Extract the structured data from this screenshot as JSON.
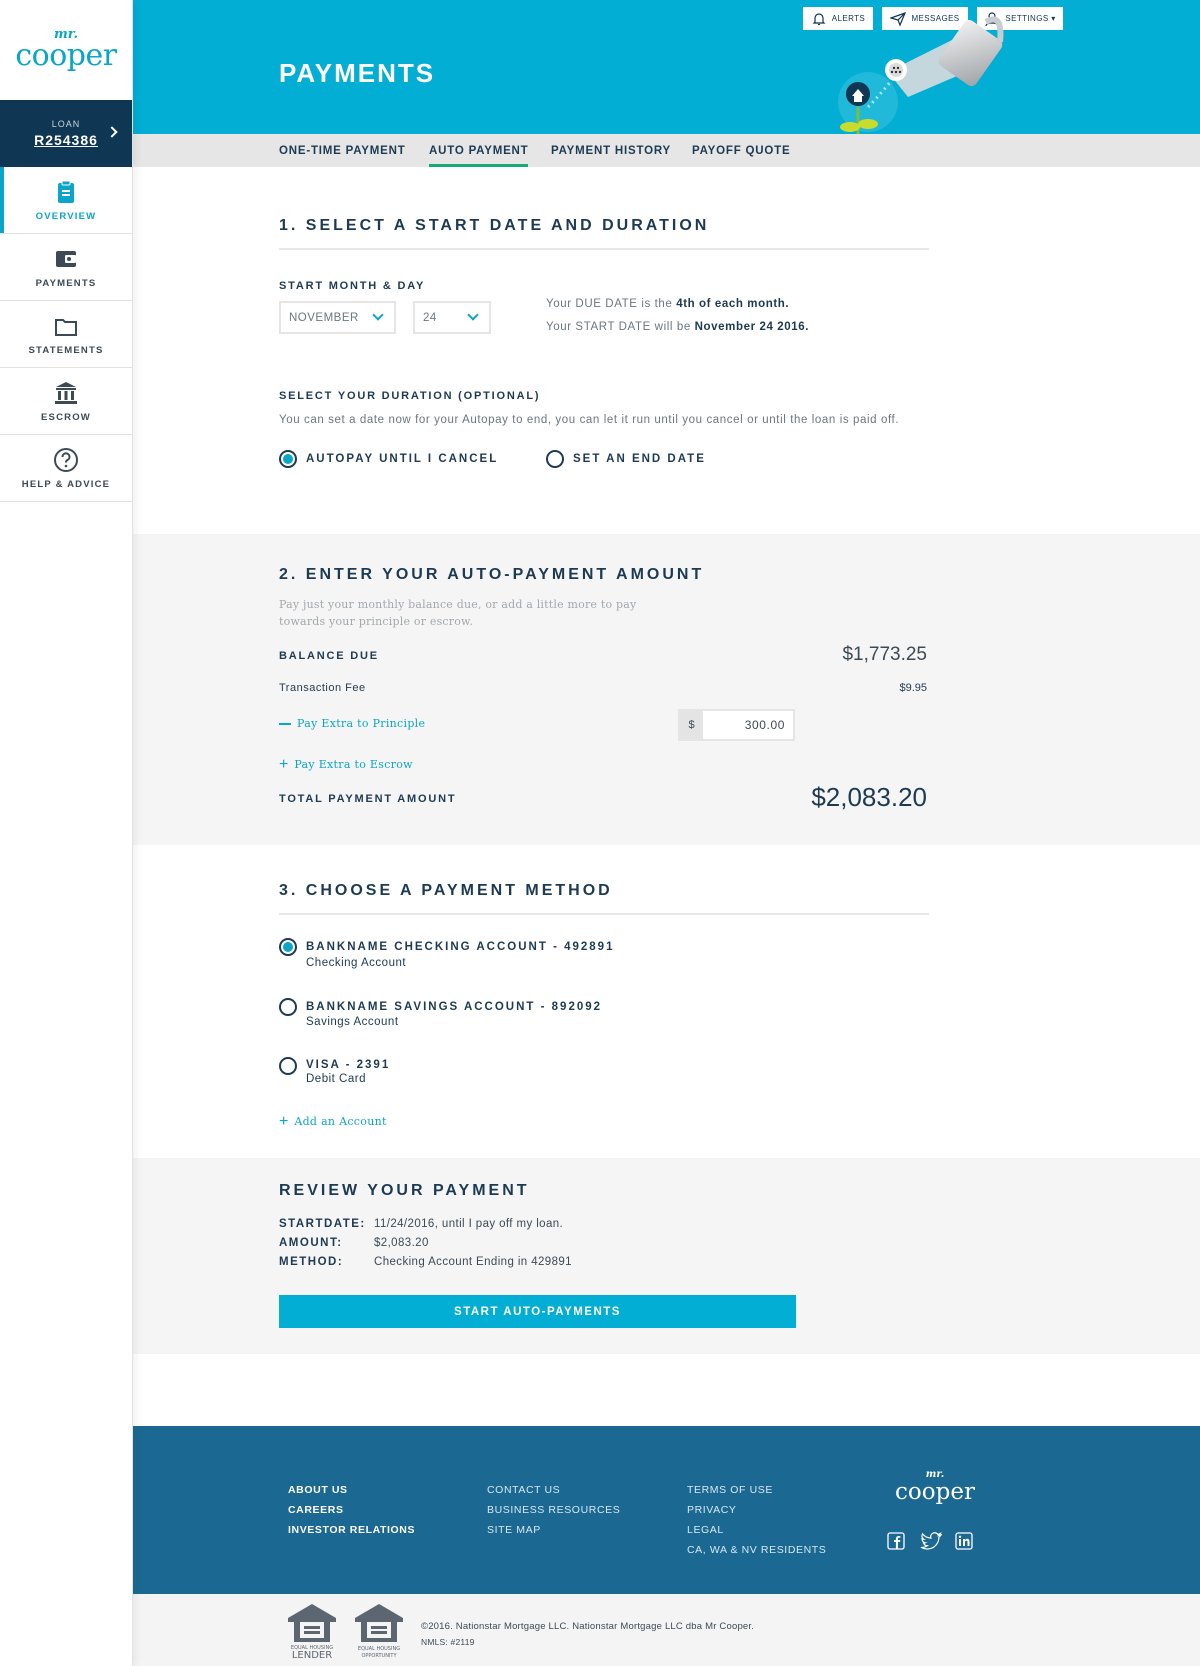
{
  "brand": {
    "mr": "mr.",
    "cooper": "cooper"
  },
  "loan": {
    "label": "LOAN",
    "number": "R254386"
  },
  "sidebar": {
    "items": [
      {
        "label": "OVERVIEW",
        "icon": "clipboard-icon"
      },
      {
        "label": "PAYMENTS",
        "icon": "wallet-icon"
      },
      {
        "label": "STATEMENTS",
        "icon": "folder-icon"
      },
      {
        "label": "ESCROW",
        "icon": "bank-icon"
      },
      {
        "label": "HELP & ADVICE",
        "icon": "question-icon"
      }
    ]
  },
  "header": {
    "title": "PAYMENTS",
    "alerts": "ALERTS",
    "messages": "MESSAGES",
    "settings": "SETTINGS ▾"
  },
  "tabs": [
    {
      "label": "ONE-TIME PAYMENT"
    },
    {
      "label": "AUTO PAYMENT",
      "active": true
    },
    {
      "label": "PAYMENT HISTORY"
    },
    {
      "label": "PAYOFF QUOTE"
    }
  ],
  "step1": {
    "heading": "1. SELECT A START DATE AND DURATION",
    "start_label": "START MONTH & DAY",
    "month": "NOVEMBER",
    "day": "24",
    "due_prefix": "Your DUE DATE is the ",
    "due_value": "4th of each month.",
    "start_prefix": "Your START DATE will be ",
    "start_value": "November 24 2016.",
    "duration_label": "SELECT YOUR DURATION (OPTIONAL)",
    "duration_help": "You can set a date now for your Autopay to end, you can let it run until you cancel or until the loan is paid off.",
    "option_cancel": "AUTOPAY UNTIL I CANCEL",
    "option_end": "SET AN END DATE"
  },
  "step2": {
    "heading": "2. ENTER YOUR AUTO-PAYMENT AMOUNT",
    "help": "Pay just your monthly balance due, or add a little more to pay towards your principle or escrow.",
    "balance_label": "BALANCE DUE",
    "balance_value": "$1,773.25",
    "fee_label": "Transaction Fee",
    "fee_value": "$9.95",
    "extra_principle_label": "Pay Extra to Principle",
    "currency": "$",
    "extra_principle_value": "300.00",
    "extra_escrow_label": "Pay Extra to Escrow",
    "total_label": "TOTAL PAYMENT AMOUNT",
    "total_value": "$2,083.20"
  },
  "step3": {
    "heading": "3. CHOOSE A PAYMENT METHOD",
    "methods": [
      {
        "name": "BANKNAME CHECKING ACCOUNT - 492891",
        "type": "Checking Account",
        "selected": true
      },
      {
        "name": "BANKNAME SAVINGS ACCOUNT - 892092",
        "type": "Savings Account"
      },
      {
        "name": "VISA - 2391",
        "type": "Debit Card"
      }
    ],
    "add_account": "Add an Account"
  },
  "review": {
    "heading": "REVIEW YOUR PAYMENT",
    "startdate_key": "STARTDATE:",
    "startdate_val": "11/24/2016, until I pay off my loan.",
    "amount_key": "AMOUNT:",
    "amount_val": "$2,083.20",
    "method_key": "METHOD:",
    "method_val": "Checking Account Ending in 429891",
    "button": "START AUTO-PAYMENTS"
  },
  "footer": {
    "col1": [
      "ABOUT US",
      "CAREERS",
      "INVESTOR RELATIONS"
    ],
    "col2": [
      "CONTACT US",
      "BUSINESS RESOURCES",
      "SITE MAP"
    ],
    "col3": [
      "TERMS OF USE",
      "PRIVACY",
      "LEGAL",
      "CA, WA & NV RESIDENTS"
    ],
    "social": [
      "facebook-icon",
      "twitter-icon",
      "linkedin-icon"
    ]
  },
  "legal": {
    "lender_badge": "EQUAL HOUSING LENDER",
    "opportunity_badge": "EQUAL HOUSING OPPORTUNITY",
    "copyright": "©2016. Nationstar Mortgage LLC. Nationstar Mortgage LLC dba Mr Cooper.",
    "nmls": "NMLS: #2119"
  },
  "colors": {
    "accent": "#02aed3",
    "navy": "#1d3a53",
    "footer": "#1b6992",
    "tab_underline": "#17a97a"
  }
}
